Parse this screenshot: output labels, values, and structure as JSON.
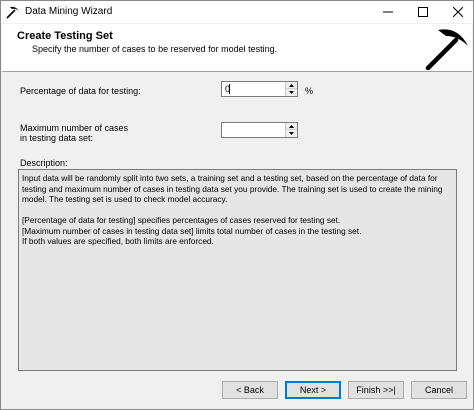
{
  "window": {
    "title": "Data Mining Wizard"
  },
  "header": {
    "title": "Create Testing Set",
    "subtitle": "Specify the number of cases to be reserved for model testing."
  },
  "form": {
    "percentage_label": "Percentage of data for testing:",
    "percentage_value": "0",
    "percentage_unit": "%",
    "max_cases_label_line1": "Maximum number of cases",
    "max_cases_label_line2": "in testing data set:",
    "max_cases_value": "",
    "description_label": "Description:"
  },
  "description": {
    "para1": "Input data will be randomly split into two sets, a training set and a testing set, based on the percentage of data for testing and maximum number of cases in testing data set you provide. The training set is used to create the mining model. The testing set is used to check model accuracy.",
    "para2_line1": "[Percentage of data for testing] specifies percentages of cases reserved for testing set.",
    "para2_line2": "[Maximum number of cases in testing data set] limits total number of cases in the testing set.",
    "para2_line3": "If both values are specified, both limits are enforced."
  },
  "buttons": {
    "back": "< Back",
    "next": "Next >",
    "finish": "Finish >>|",
    "cancel": "Cancel"
  },
  "icons": {
    "app": "pickaxe-icon",
    "header_graphic": "pickaxe-icon",
    "minimize": "minimize-icon",
    "maximize": "maximize-icon",
    "close": "close-icon",
    "spin_up": "arrow-up-icon",
    "spin_down": "arrow-down-icon"
  },
  "colors": {
    "accent": "#0078d7",
    "window_bg": "#f0f0f0",
    "description_bg": "#e6e6e6"
  }
}
